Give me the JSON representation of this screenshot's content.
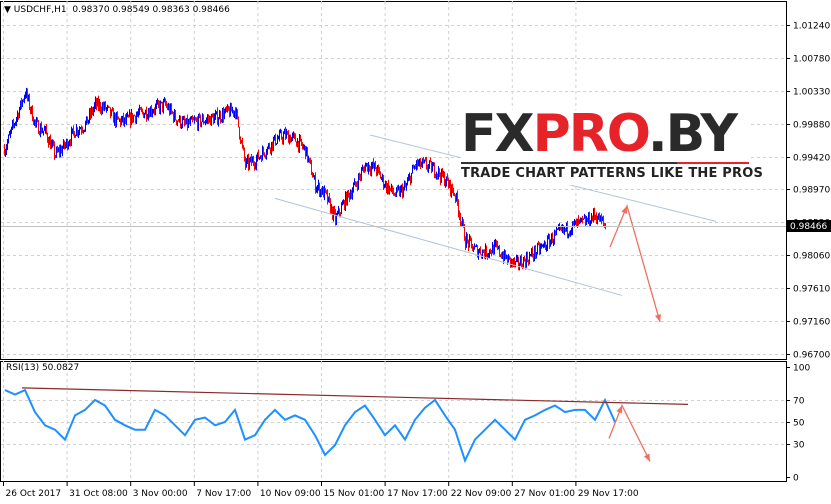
{
  "header": {
    "symbol": "USDCHF,H1",
    "ohlc": "0.98370 0.98549 0.98363 0.98466"
  },
  "rsi_header": {
    "label": "RSI(13) 50.0827"
  },
  "logo": {
    "text_black_1": "FX",
    "text_red": "PRO",
    "text_black_2": ".BY",
    "tagline": "TRADE CHART PATTERNS LIKE THE PROS"
  },
  "colors": {
    "up": "#0000ff",
    "down": "#ff0000",
    "rsi": "#1e90ff",
    "trendline": "#8b2a2a",
    "channel": "#b0c4d8",
    "arrow": "#f07060",
    "grid": "#d0d0d0"
  },
  "chart_data": [
    {
      "type": "bar",
      "name": "price",
      "ylim": [
        0.967,
        1.0124
      ],
      "price_ticks": [
        "1.01240",
        "1.00780",
        "1.00330",
        "0.99880",
        "0.99420",
        "0.98970",
        "0.98520",
        "0.98060",
        "0.97610",
        "0.97160",
        "0.96700"
      ],
      "current_price": "0.98466",
      "time_ticks": [
        "26 Oct 2017",
        "31 Oct 08:00",
        "3 Nov 00:00",
        "7 Nov 17:00",
        "10 Nov 09:00",
        "15 Nov 01:00",
        "17 Nov 17:00",
        "22 Nov 09:00",
        "27 Nov 01:00",
        "29 Nov 17:00"
      ],
      "close": [
        0.99543,
        0.99929,
        1.00315,
        0.9986,
        0.99763,
        0.99446,
        0.99584,
        0.99791,
        0.9986,
        1.00136,
        1.00095,
        0.99929,
        0.99901,
        0.99998,
        1.00039,
        1.00095,
        1.00136,
        0.99957,
        0.9986,
        0.99901,
        0.99929,
        0.99957,
        1.00026,
        1.00067,
        0.99308,
        0.99377,
        0.99515,
        0.99653,
        0.99722,
        0.99653,
        0.99515,
        0.99032,
        0.98894,
        0.98549,
        0.98825,
        0.99032,
        0.99308,
        0.99267,
        0.99032,
        0.98894,
        0.98991,
        0.99308,
        0.99308,
        0.99239,
        0.99101,
        0.98894,
        0.98273,
        0.98135,
        0.98107,
        0.98163,
        0.98025,
        0.97928,
        0.97997,
        0.98107,
        0.98204,
        0.98342,
        0.98411,
        0.9848,
        0.98521,
        0.98618,
        0.98466
      ],
      "annotations": {
        "channel_upper": [
          [
            36.5,
            0.99722
          ],
          [
            71.1,
            0.9853
          ]
        ],
        "channel_lower": [
          [
            27,
            0.98847
          ],
          [
            61.7,
            0.97508
          ]
        ],
        "arrow": [
          [
            60.5,
            0.98176
          ],
          [
            62.2,
            0.98742
          ],
          [
            65.5,
            0.97141
          ]
        ]
      }
    },
    {
      "type": "line",
      "name": "RSI(13)",
      "ylim": [
        0,
        100
      ],
      "ticks": [
        "100",
        "70",
        "50",
        "30",
        "0"
      ],
      "values": [
        79,
        75,
        79,
        59,
        47,
        43,
        34,
        56,
        61,
        70,
        65,
        52,
        47,
        43,
        43,
        61,
        56,
        47,
        38,
        52,
        54,
        47,
        50,
        61,
        34,
        38,
        52,
        61,
        52,
        56,
        52,
        38,
        20,
        29,
        47,
        59,
        65,
        52,
        38,
        47,
        34,
        52,
        63,
        70,
        56,
        43,
        15,
        34,
        43,
        52,
        43,
        34,
        52,
        56,
        61,
        65,
        59,
        61,
        61,
        52,
        70,
        50.08
      ],
      "annotations": {
        "trendline": [
          [
            1.7,
            81
          ],
          [
            68.3,
            66
          ]
        ],
        "arrow": [
          [
            60.4,
            35
          ],
          [
            61.7,
            65
          ],
          [
            64.5,
            14
          ]
        ]
      }
    }
  ]
}
